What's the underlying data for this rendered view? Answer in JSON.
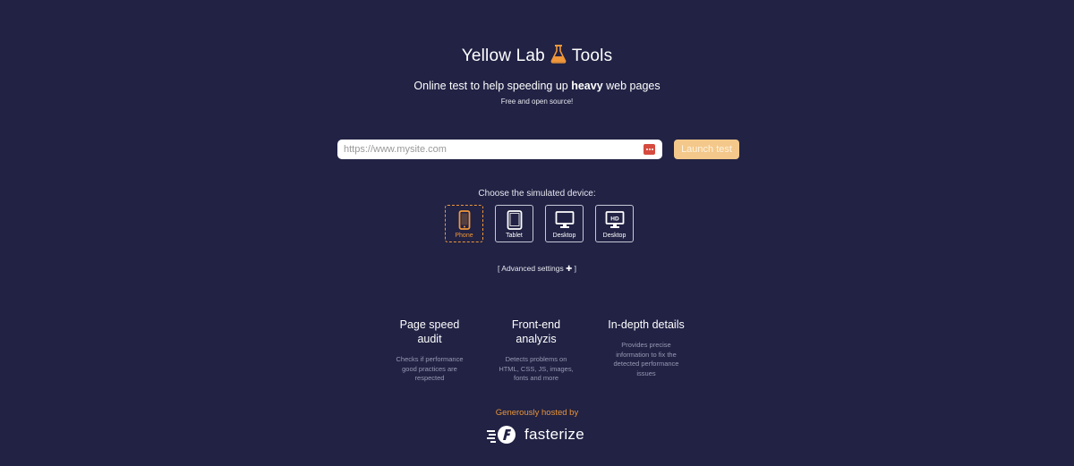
{
  "header": {
    "title_part1": "Yellow Lab",
    "title_part2": "Tools",
    "subtitle_before": "Online test to help speeding up ",
    "subtitle_bold": "heavy",
    "subtitle_after": " web pages",
    "tagline": "Free and open source!"
  },
  "form": {
    "url_placeholder": "https://www.mysite.com",
    "launch_label": "Launch test"
  },
  "devices": {
    "label": "Choose the simulated device:",
    "items": [
      {
        "label": "Phone",
        "icon": "phone-icon",
        "selected": true
      },
      {
        "label": "Tablet",
        "icon": "tablet-icon",
        "selected": false
      },
      {
        "label": "Desktop",
        "icon": "desktop-icon",
        "selected": false
      },
      {
        "label": "Desktop",
        "icon": "desktop-hd-icon",
        "badge": "HD",
        "selected": false
      }
    ]
  },
  "advanced": {
    "open_bracket": "[",
    "label": "Advanced settings",
    "close_bracket": "]"
  },
  "features": [
    {
      "title_line1": "Page speed",
      "title_line2": "audit",
      "desc": [
        "Checks if performance",
        "good practices are",
        "respected"
      ]
    },
    {
      "title_line1": "Front-end",
      "title_line2": "analyzis",
      "desc": [
        "Detects problems on",
        "HTML, CSS, JS, images,",
        "fonts and more"
      ]
    },
    {
      "title_line1": "In-depth details",
      "title_line2": "",
      "desc": [
        "Provides precise",
        "information to fix the",
        "detected performance",
        "issues"
      ]
    }
  ],
  "footer": {
    "hosted_label": "Generously hosted by",
    "brand_name": "fasterize"
  },
  "colors": {
    "background": "#212244",
    "accent": "#f0973a",
    "button": "#f3c88a"
  }
}
